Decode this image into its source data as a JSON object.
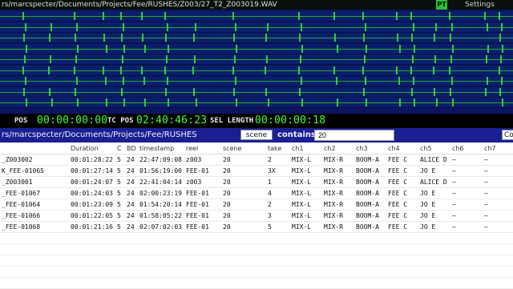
{
  "titlebar": {
    "path": "rs/marcspecter/Documents/Projects/Fee/RUSHES/Z003/27_T2_Z003019.WAV",
    "pt": "PT",
    "settings": "Settings"
  },
  "colors": {
    "wave_bg": "#0a1f6b",
    "wave": "#36e036",
    "path_bar": "#1a1f92"
  },
  "infobar": {
    "pos_label": "POS",
    "pos_value": "00:00:00:00",
    "tcpos_label": "TC POS",
    "tcpos_value": "02:40:46:23",
    "sellen_label": "SEL LENGTH",
    "sellen_value": "00:00:00:18"
  },
  "browser": {
    "path": "rs/marcspecter/Documents/Projects/Fee/RUSHES",
    "scene_button": "scene",
    "contains_label": "contains",
    "search_value": "20",
    "co_button": "Co"
  },
  "table": {
    "headers": [
      "",
      "Duration",
      "C",
      "BD",
      "timestamp",
      "reel",
      "scene",
      "take",
      "ch1",
      "ch2",
      "ch3",
      "ch4",
      "ch5",
      "ch6",
      "ch7"
    ],
    "rows": [
      [
        "_Z003002",
        "00:01:28:22",
        "5",
        "24",
        "22:47:09:08",
        "z003",
        "20",
        "2",
        "MIX-L",
        "MIX-R",
        "BOOM-A",
        "FEE C",
        "ALICE D",
        "–",
        "–"
      ],
      [
        "K_FEE-01065",
        "00:01:27:14",
        "5",
        "24",
        "01:56:19:00",
        "FEE-01",
        "20",
        "3X",
        "MIX-L",
        "MIX-R",
        "BOOM-A",
        "FEE C",
        "JO E",
        "–",
        "–"
      ],
      [
        "_Z003001",
        "00:01:24:07",
        "5",
        "24",
        "22:41:04:14",
        "z003",
        "20",
        "1",
        "MIX-L",
        "MIX-R",
        "BOOM-A",
        "FEE C",
        "ALICE D",
        "–",
        "–"
      ],
      [
        "_FEE-01067",
        "00:01:24:03",
        "5",
        "24",
        "02:00:23:19",
        "FEE-01",
        "20",
        "4",
        "MIX-L",
        "MIX-R",
        "BOOM-A",
        "FEE C",
        "JO E",
        "–",
        "–"
      ],
      [
        "_FEE-01064",
        "00:01:23:09",
        "5",
        "24",
        "01:54:20:14",
        "FEE-01",
        "20",
        "2",
        "MIX-L",
        "MIX-R",
        "BOOM-A",
        "FEE C",
        "JO E",
        "–",
        "–"
      ],
      [
        "_FEE-01066",
        "00:01:22:05",
        "5",
        "24",
        "01:58:05:22",
        "FEE-01",
        "20",
        "3",
        "MIX-L",
        "MIX-R",
        "BOOM-A",
        "FEE C",
        "JO E",
        "–",
        "–"
      ],
      [
        "_FEE-01068",
        "00:01:21:16",
        "5",
        "24",
        "02:07:02:03",
        "FEE-01",
        "20",
        "5",
        "MIX-L",
        "MIX-R",
        "BOOM-A",
        "FEE C",
        "JO E",
        "–",
        "–"
      ]
    ]
  }
}
